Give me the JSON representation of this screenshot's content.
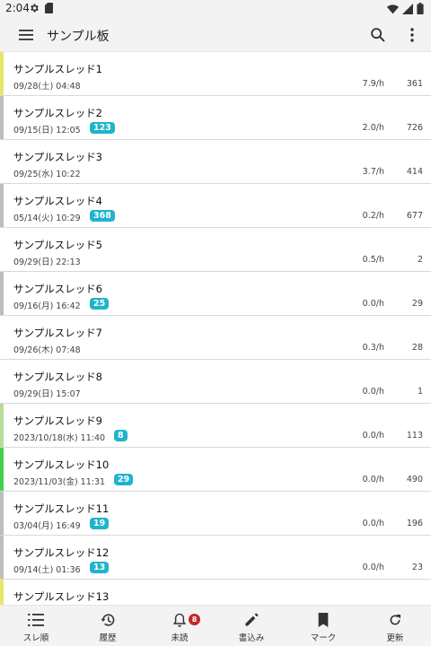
{
  "status": {
    "time": "2:04"
  },
  "appbar": {
    "title": "サンプル板"
  },
  "threads": [
    {
      "title": "サンプルスレッド1",
      "date": "09/28(土) 04:48",
      "unread": "",
      "speed": "7.9/h",
      "count": "361",
      "accent": "#e6e86a"
    },
    {
      "title": "サンプルスレッド2",
      "date": "09/15(日) 12:05",
      "unread": "123",
      "speed": "2.0/h",
      "count": "726",
      "accent": "#bdbdbd"
    },
    {
      "title": "サンプルスレッド3",
      "date": "09/25(水) 10:22",
      "unread": "",
      "speed": "3.7/h",
      "count": "414",
      "accent": ""
    },
    {
      "title": "サンプルスレッド4",
      "date": "05/14(火) 10:29",
      "unread": "368",
      "speed": "0.2/h",
      "count": "677",
      "accent": "#bdbdbd"
    },
    {
      "title": "サンプルスレッド5",
      "date": "09/29(日) 22:13",
      "unread": "",
      "speed": "0.5/h",
      "count": "2",
      "accent": ""
    },
    {
      "title": "サンプルスレッド6",
      "date": "09/16(月) 16:42",
      "unread": "25",
      "speed": "0.0/h",
      "count": "29",
      "accent": "#bdbdbd"
    },
    {
      "title": "サンプルスレッド7",
      "date": "09/26(木) 07:48",
      "unread": "",
      "speed": "0.3/h",
      "count": "28",
      "accent": ""
    },
    {
      "title": "サンプルスレッド8",
      "date": "09/29(日) 15:07",
      "unread": "",
      "speed": "0.0/h",
      "count": "1",
      "accent": ""
    },
    {
      "title": "サンプルスレッド9",
      "date": "2023/10/18(水) 11:40",
      "unread": "8",
      "speed": "0.0/h",
      "count": "113",
      "accent": "#b6dc9a"
    },
    {
      "title": "サンプルスレッド10",
      "date": "2023/11/03(金) 11:31",
      "unread": "29",
      "speed": "0.0/h",
      "count": "490",
      "accent": "#43d14b"
    },
    {
      "title": "サンプルスレッド11",
      "date": "03/04(月) 16:49",
      "unread": "19",
      "speed": "0.0/h",
      "count": "196",
      "accent": "#bdbdbd"
    },
    {
      "title": "サンプルスレッド12",
      "date": "09/14(土) 01:36",
      "unread": "13",
      "speed": "0.0/h",
      "count": "23",
      "accent": "#bdbdbd"
    },
    {
      "title": "サンプルスレッド13",
      "date": "",
      "unread": "",
      "speed": "",
      "count": "",
      "accent": "#e6e86a"
    }
  ],
  "bottomnav": [
    {
      "label": "スレ順",
      "icon": "sort-list-icon",
      "badge": ""
    },
    {
      "label": "履歴",
      "icon": "history-icon",
      "badge": ""
    },
    {
      "label": "未読",
      "icon": "bell-icon",
      "badge": "8"
    },
    {
      "label": "書込み",
      "icon": "pencil-icon",
      "badge": ""
    },
    {
      "label": "マーク",
      "icon": "bookmark-icon",
      "badge": ""
    },
    {
      "label": "更新",
      "icon": "refresh-icon",
      "badge": ""
    }
  ]
}
